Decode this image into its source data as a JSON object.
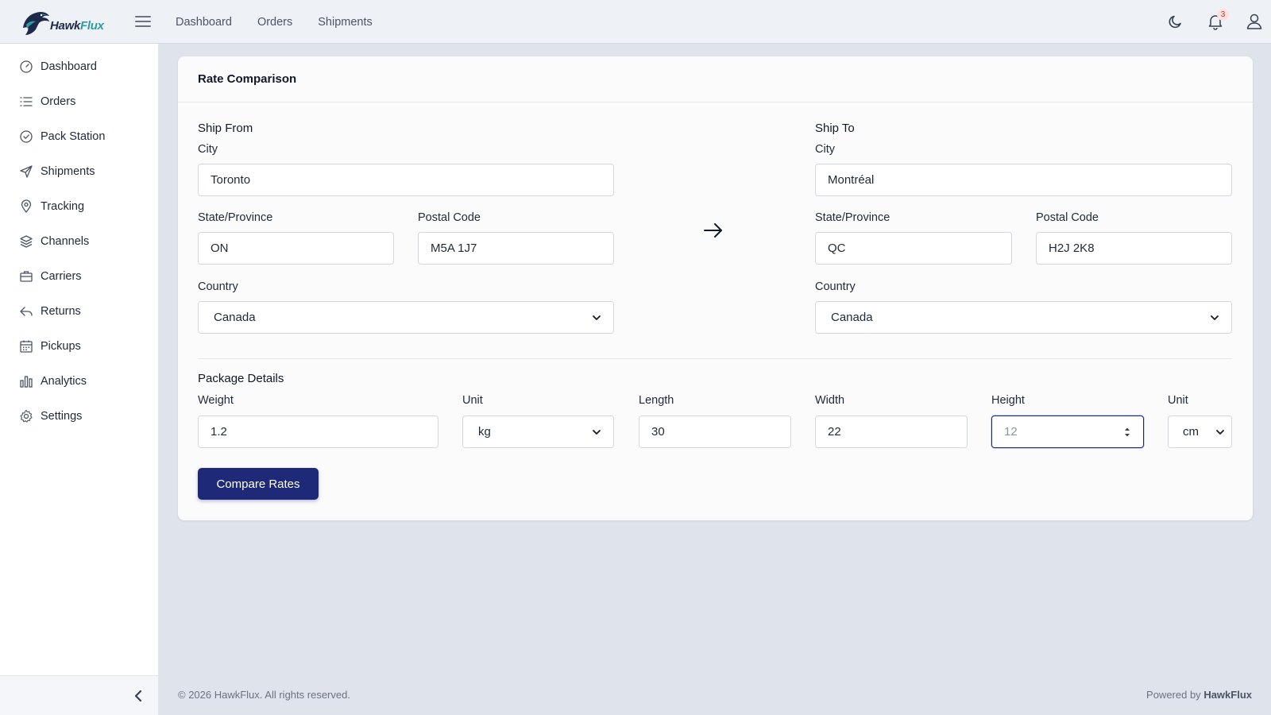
{
  "brand": {
    "name_main": "Hawk",
    "name_accent": "Flux"
  },
  "topnav": [
    "Dashboard",
    "Orders",
    "Shipments"
  ],
  "notifications": {
    "count": "3"
  },
  "sidebar": {
    "items": [
      {
        "label": "Dashboard",
        "icon": "gauge-icon"
      },
      {
        "label": "Orders",
        "icon": "list-icon"
      },
      {
        "label": "Pack Station",
        "icon": "check-circle-icon"
      },
      {
        "label": "Shipments",
        "icon": "send-icon"
      },
      {
        "label": "Tracking",
        "icon": "map-pin-icon"
      },
      {
        "label": "Channels",
        "icon": "layers-icon"
      },
      {
        "label": "Carriers",
        "icon": "briefcase-icon"
      },
      {
        "label": "Returns",
        "icon": "reply-icon"
      },
      {
        "label": "Pickups",
        "icon": "calendar-icon"
      },
      {
        "label": "Analytics",
        "icon": "bar-chart-icon"
      },
      {
        "label": "Settings",
        "icon": "gear-icon"
      }
    ]
  },
  "card": {
    "title": "Rate Comparison",
    "ship_from": {
      "title": "Ship From",
      "city_label": "City",
      "city": "Toronto",
      "state_label": "State/Province",
      "state": "ON",
      "postal_label": "Postal Code",
      "postal": "M5A 1J7",
      "country_label": "Country",
      "country": "Canada"
    },
    "ship_to": {
      "title": "Ship To",
      "city_label": "City",
      "city": "Montréal",
      "state_label": "State/Province",
      "state": "QC",
      "postal_label": "Postal Code",
      "postal": "H2J 2K8",
      "country_label": "Country",
      "country": "Canada"
    },
    "package": {
      "title": "Package Details",
      "weight_label": "Weight",
      "weight": "1.2",
      "weight_unit_label": "Unit",
      "weight_unit": "kg",
      "length_label": "Length",
      "length": "30",
      "width_label": "Width",
      "width": "22",
      "height_label": "Height",
      "height": "12",
      "dim_unit_label": "Unit",
      "dim_unit": "cm"
    },
    "button": "Compare Rates"
  },
  "footer": {
    "copyright": "© 2026 HawkFlux. All rights reserved.",
    "powered_prefix": "Powered by",
    "powered_brand": "HawkFlux"
  },
  "colors": {
    "primary": "#1e2a78",
    "accent": "#2c9ca3",
    "badge": "#d92d20"
  }
}
